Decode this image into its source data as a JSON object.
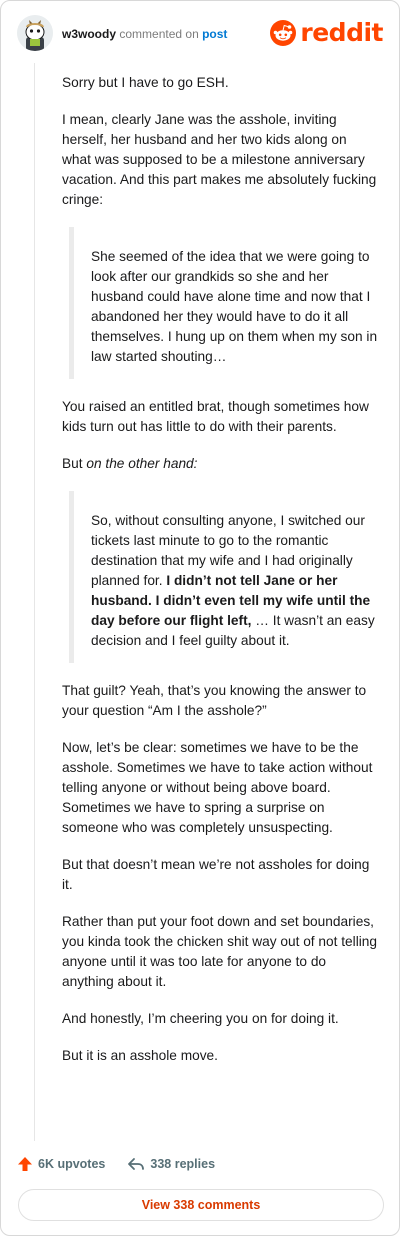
{
  "header": {
    "username": "w3woody",
    "commented_on_text": "commented on",
    "post_link": "post",
    "logo_text": "reddit"
  },
  "comment": {
    "p1": "Sorry but I have to go ESH.",
    "p2": "I mean, clearly Jane was the asshole, inviting herself, her husband and her two kids along on what was supposed to be a milestone anniversary vacation. And this part makes me absolutely fucking cringe:",
    "quote1": "She seemed of the idea that we were going to look after our grandkids so she and her husband could have alone time and now that I abandoned her they would have to do it all themselves. I hung up on them when my son in law started shouting…",
    "p3": "You raised an entitled brat, though sometimes how kids turn out has little to do with their parents.",
    "p4_prefix": "But ",
    "p4_italic": "on the other hand:",
    "quote2_part1": "So, without consulting anyone, I switched our tickets last minute to go to the romantic destination that my wife and I had originally planned for. ",
    "quote2_bold": "I didn’t not tell Jane or her husband. I didn’t even tell my wife until the day before our flight left,",
    "quote2_part2": " … It wasn’t an easy decision and I feel guilty about it.",
    "p5": "That guilt? Yeah, that’s you knowing the answer to your question “Am I the asshole?”",
    "p6": "Now, let’s be clear: sometimes we have to be the asshole. Sometimes we have to take action without telling anyone or without being above board. Sometimes we have to spring a surprise on someone who was completely unsuspecting.",
    "p7": "But that doesn’t mean we’re not assholes for doing it.",
    "p8": "Rather than put your foot down and set boundaries, you kinda took the chicken shit way out of not telling anyone until it was too late for anyone to do anything about it.",
    "p9": "And honestly, I’m cheering you on for doing it.",
    "p10": "But it is an asshole move."
  },
  "footer": {
    "upvotes": "6K upvotes",
    "replies": "338 replies",
    "view_button": "View 338 comments"
  },
  "colors": {
    "brand": "#ff4500",
    "link": "#0079d3",
    "meta": "#576f76"
  }
}
